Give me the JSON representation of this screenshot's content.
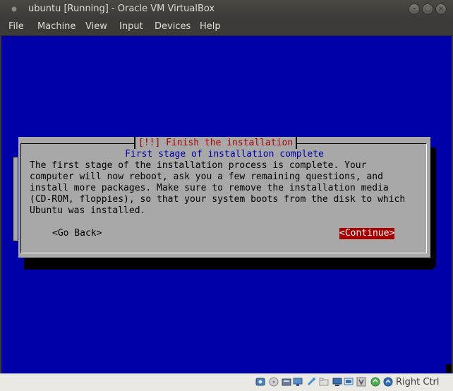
{
  "window": {
    "title": "ubuntu [Running] - Oracle VM VirtualBox"
  },
  "menubar": {
    "items": [
      "File",
      "Machine",
      "View",
      "Input",
      "Devices",
      "Help"
    ]
  },
  "installer": {
    "title": "[!!] Finish the installation",
    "subtitle": "First stage of installation complete",
    "body": [
      "The first stage of the installation process is complete. Your",
      "computer will now reboot, ask you a few remaining questions, and",
      "install more packages. Make sure to remove the installation media",
      "(CD-ROM, floppies), so that your system boots from the disk to which",
      "Ubuntu was installed."
    ],
    "go_back": "<Go Back>",
    "continue": "<Continue>"
  },
  "statusbar": {
    "icons": [
      "hard-disk-icon",
      "optical-drive-icon",
      "audio-icon",
      "network-icon",
      "usb-icon",
      "shared-folders-icon",
      "display-icon",
      "video-capture-icon",
      "virtualization-icon",
      "mouse-integration-icon",
      "keyboard-icon"
    ],
    "host_key": "Right Ctrl"
  },
  "colors": {
    "screen_bg": "#0000a8",
    "dialog_bg": "#a8a8a8",
    "title_fg": "#a80000",
    "highlight_bg": "#a80000"
  }
}
